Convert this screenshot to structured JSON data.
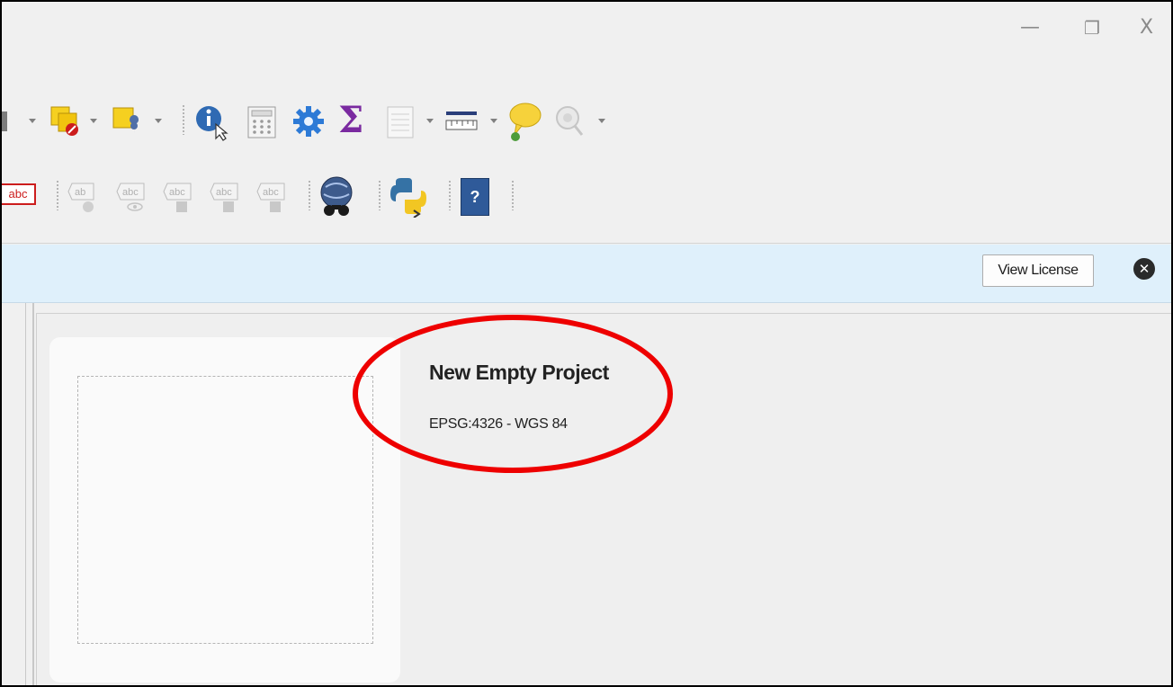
{
  "window_controls": {
    "minimize": "—",
    "restore": "❐",
    "close": "X"
  },
  "message_bar": {
    "view_license_label": "View License"
  },
  "welcome": {
    "project_title": "New Empty Project",
    "project_crs": "EPSG:4326 - WGS 84"
  },
  "icons": {
    "label_abc": "abc",
    "help": "?",
    "sum": "Σ"
  },
  "colors": {
    "message_bar_bg": "#dff0fb",
    "annotation": "#ee0000",
    "sum_purple": "#7a2aa0"
  }
}
